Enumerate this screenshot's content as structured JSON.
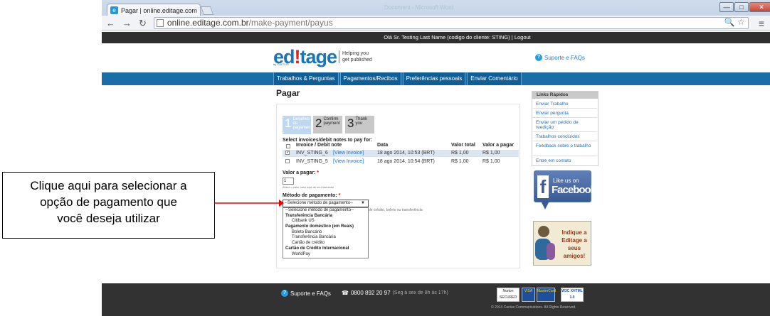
{
  "browser": {
    "tab_title": "Pagar | online.editage.com",
    "tab_favicon": "editage-favicon",
    "tab_close": "×",
    "ghost_window_title": "Document - Microsoft Word",
    "url_host": "online.editage.com.br",
    "url_path": "/make-payment/payus",
    "back": "←",
    "forward": "→",
    "reload": "↻",
    "window_buttons": {
      "minimize": "—",
      "maximize": "□",
      "close": "✕"
    },
    "address_icons": "🔍 ☆",
    "menu_icon": "≡"
  },
  "site": {
    "greeting": "Olá Sr. Testing Last Name (codigo do cliente: STING)",
    "logout": "| Logout",
    "logo": {
      "part1": "ed",
      "bang": "!",
      "part2": "tage",
      "by": "by CACTUS"
    },
    "tagline": {
      "line1": "Helping you",
      "line2": "get published"
    },
    "support_link": "Suporte e FAQs",
    "nav": [
      "Trabalhos & Perguntas",
      "Pagamentos/Recibos",
      "Preferências pessoais",
      "Enviar Comentário"
    ],
    "page_title": "Pagar"
  },
  "steps": [
    {
      "num": "1",
      "label": "Detalhes do pagamento",
      "active": true
    },
    {
      "num": "2",
      "label": "Confirm payment",
      "active": false
    },
    {
      "num": "3",
      "label": "Thank you",
      "active": false
    }
  ],
  "invoices": {
    "heading": "Select invoices/debit notes to pay for:",
    "headers": [
      "Invoice / Debit note",
      "Data",
      "Valor total",
      "Valor a pagar"
    ],
    "rows": [
      {
        "id": "INV_STING_6",
        "link": "[View Invoice]",
        "date": "18 ago 2014, 10:53 (BRT)",
        "total": "R$ 1,00",
        "topay": "R$ 1,00",
        "checked": true
      },
      {
        "id": "INV_STING_5",
        "link": "[View Invoice]",
        "date": "18 ago 2014, 10:54 (BRT)",
        "total": "R$ 1,00",
        "topay": "R$ 1,00",
        "checked": false
      }
    ]
  },
  "valor": {
    "label": "Valor a pagar:",
    "required": "*",
    "value": "1",
    "hint": "Altere o valor caso seja de seu interesse"
  },
  "metodo": {
    "label": "Método de pagamento:",
    "required": "*",
    "selected": "--Selecione método de pagamento--",
    "hint": "de crédito, boleto ou transferência",
    "options": [
      {
        "t": "--Selecione método de pagamento--",
        "k": "o0"
      },
      {
        "t": "Transferência Bancária",
        "k": "g"
      },
      {
        "t": "Citibank US",
        "k": "o"
      },
      {
        "t": "Pagamento doméstico (em Reais)",
        "k": "g"
      },
      {
        "t": "Boleto Bancário",
        "k": "o"
      },
      {
        "t": "Transferência Bancária",
        "k": "o"
      },
      {
        "t": "Cartão de crédito",
        "k": "o"
      },
      {
        "t": "Cartão de Crédito Internacional",
        "k": "g"
      },
      {
        "t": "WorldPay",
        "k": "o"
      }
    ]
  },
  "quicklinks": {
    "title": "Links Rápidos",
    "items": [
      "Enviar Trabalho",
      "Enviar pergunta",
      "Enviar um pedido de reedição",
      "Trabalhos concluídos",
      "Feedback sobre o trabalho",
      "Entre em contato"
    ]
  },
  "facebook": {
    "f": "f",
    "line1": "Like us on",
    "line2": "Facebook"
  },
  "indique": "Indique a Editage a seus amigos!",
  "callout": [
    "Clique aqui para selecionar a",
    "opção de pagamento que",
    "você deseja utilizar"
  ],
  "footer": {
    "support": "Suporte e FAQs",
    "phone": "0800 892 20 97",
    "hours": "(Seg à sex de 8h às 17h)",
    "badges": [
      "Norton SECURED",
      "VISA",
      "MasterCard",
      "W3C XHTML 1.0"
    ],
    "copyright": "© 2014 Cactus Communications. All Rights Reserved."
  },
  "colors": {
    "nav": "#1a6ea8",
    "accent": "#1e7fc2",
    "dark": "#323232"
  }
}
